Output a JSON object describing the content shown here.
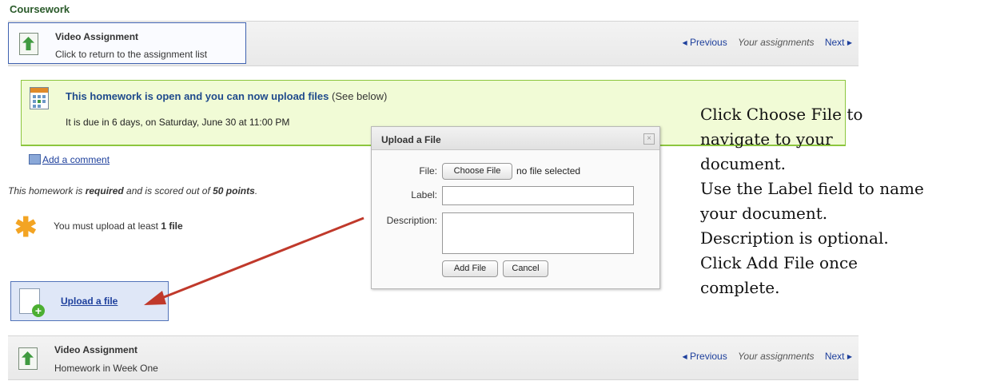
{
  "page_title": "Coursework",
  "top_bar": {
    "assignment_title": "Video Assignment",
    "assignment_subtitle": "Click to return to the assignment list",
    "nav": {
      "previous": "Previous",
      "your_assignments": "Your assignments",
      "next": "Next"
    }
  },
  "status": {
    "title": "This homework is open and you can now upload files",
    "title_suffix": " (See below)",
    "due": "It is due in 6 days, on Saturday, June 30 at 11:00 PM"
  },
  "add_comment": "Add a comment",
  "required_text": {
    "prefix": "This homework is ",
    "required": "required",
    "middle": " and is scored out of ",
    "points": "50 points",
    "suffix": "."
  },
  "upload_min": {
    "prefix": "You must upload at least ",
    "count": "1 file"
  },
  "upload_link": "Upload a file",
  "dialog": {
    "title": "Upload a File",
    "file_label": "File:",
    "choose_file": "Choose File",
    "no_file": "no file selected",
    "label_label": "Label:",
    "description_label": "Description:",
    "add_file": "Add File",
    "cancel": "Cancel"
  },
  "instructions": [
    "Click Choose File to",
    "navigate to your",
    "document.",
    "Use the Label field to name",
    "your document.",
    "Description is optional.",
    "Click Add File once",
    "complete."
  ],
  "bottom_bar": {
    "assignment_title": "Video Assignment",
    "assignment_subtitle": "Homework in Week One",
    "nav": {
      "previous": "Previous",
      "your_assignments": "Your assignments",
      "next": "Next"
    }
  },
  "colors": {
    "accent_link": "#1d3f9c",
    "status_bg": "#f1fbd6",
    "status_border": "#8cc63e",
    "arrow": "#c0392b"
  }
}
